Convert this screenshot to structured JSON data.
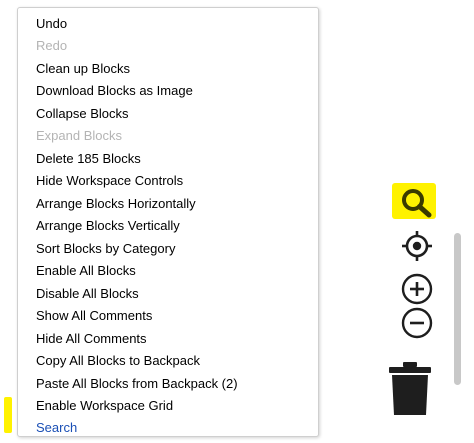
{
  "context_menu": {
    "items": [
      {
        "label": "Undo",
        "enabled": true
      },
      {
        "label": "Redo",
        "enabled": false
      },
      {
        "label": "Clean up Blocks",
        "enabled": true
      },
      {
        "label": "Download Blocks as Image",
        "enabled": true
      },
      {
        "label": "Collapse Blocks",
        "enabled": true
      },
      {
        "label": "Expand Blocks",
        "enabled": false
      },
      {
        "label": "Delete 185 Blocks",
        "enabled": true
      },
      {
        "label": "Hide Workspace Controls",
        "enabled": true
      },
      {
        "label": "Arrange Blocks Horizontally",
        "enabled": true
      },
      {
        "label": "Arrange Blocks Vertically",
        "enabled": true
      },
      {
        "label": "Sort Blocks by Category",
        "enabled": true
      },
      {
        "label": "Enable All Blocks",
        "enabled": true
      },
      {
        "label": "Disable All Blocks",
        "enabled": true
      },
      {
        "label": "Show All Comments",
        "enabled": true
      },
      {
        "label": "Hide All Comments",
        "enabled": true
      },
      {
        "label": "Copy All Blocks to Backpack",
        "enabled": true
      },
      {
        "label": "Paste All Blocks from Backpack (2)",
        "enabled": true
      },
      {
        "label": "Enable Workspace Grid",
        "enabled": true
      },
      {
        "label": "Search",
        "enabled": true,
        "active": true
      }
    ]
  },
  "workspace_tools": {
    "icons": [
      "search-icon",
      "target-icon",
      "zoom-in-icon",
      "zoom-out-icon",
      "trash-icon"
    ],
    "highlight_color": "#fff200"
  },
  "colors": {
    "text": "#000000",
    "disabled_text": "#b4b4b4",
    "active_text": "#1a4fb5",
    "tool_icon": "#1e1e1e"
  }
}
